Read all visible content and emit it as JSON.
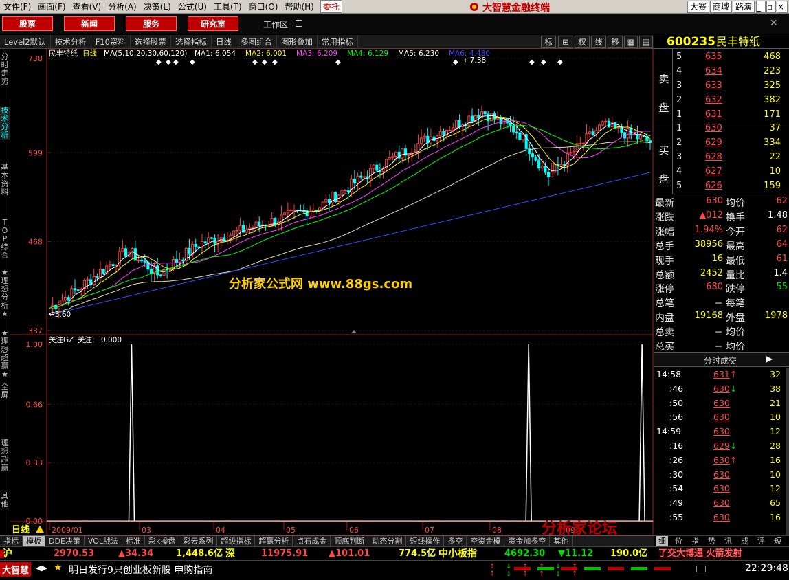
{
  "menu": {
    "items": [
      "文件(F)",
      "画面(F)",
      "查看(V)",
      "分析(A)",
      "决策(L)",
      "公式(U)",
      "工具(T)",
      "窗口(O)",
      "帮助(H)"
    ],
    "entrust": "委托",
    "brand": "大智慧金融终端",
    "right": [
      "大赛",
      "商城",
      "路演"
    ]
  },
  "toolbar": {
    "buttons": [
      "股票",
      "新闻",
      "服务",
      "研究室"
    ],
    "workarea": "工作区"
  },
  "subbar": {
    "items": [
      "Level2默认",
      "技术分析",
      "F10资料",
      "选择股票",
      "选择指标",
      "日线",
      "多图组合",
      "图形叠加",
      "常用指标"
    ],
    "right": [
      "标",
      "权",
      "线",
      "移"
    ]
  },
  "left_tabs": [
    {
      "label": "分时走势",
      "active": false
    },
    {
      "label": "技术分析",
      "active": true
    },
    {
      "label": "基本资料",
      "active": false
    },
    {
      "label": "TOP综合",
      "active": false
    },
    {
      "label": "★理想分析★",
      "active": false
    },
    {
      "label": "★理想超赢★",
      "active": false
    },
    {
      "label": "全屏",
      "active": false
    },
    {
      "label": "理想超赢",
      "active": false
    },
    {
      "label": "其他",
      "active": false
    }
  ],
  "chart_header": {
    "name": "民丰特纸",
    "period": "日线",
    "ma_title": "MA(5,10,20,30,60,120)",
    "ma": [
      {
        "label": "MA1:",
        "value": "6.054",
        "color": "#ffffff"
      },
      {
        "label": "MA2:",
        "value": "6.001",
        "color": "#ffff00"
      },
      {
        "label": "MA3:",
        "value": "6.209",
        "color": "#ff40ff"
      },
      {
        "label": "MA4:",
        "value": "6.129",
        "color": "#00ff00"
      },
      {
        "label": "MA5:",
        "value": "6.230",
        "color": "#ffffff"
      },
      {
        "label": "MA6:",
        "value": "4.480",
        "color": "#4040ff"
      }
    ]
  },
  "indicator": {
    "title": "关注GZ",
    "label": "关注:",
    "value": "0.000"
  },
  "watermark": "分析家公式网 www.88gs.com",
  "corner_logo": "分析家论坛",
  "chart_data": [
    {
      "type": "candlestick",
      "title": "民丰特纸",
      "ylim": [
        337,
        738
      ],
      "yticks": [
        "738",
        "599",
        "468",
        "337"
      ],
      "high_label": "7.38",
      "low_label": "3.60",
      "ma_colors": [
        "#ffffff",
        "#ffff00",
        "#ff40ff",
        "#00ff00",
        "#e0e0b0",
        "#3050ff"
      ]
    },
    {
      "type": "line",
      "title": "关注GZ",
      "ylim": [
        0,
        1
      ],
      "yticks": [
        "1.00",
        "0.66",
        "0.33",
        "0.00"
      ],
      "x_labels": [
        "2009/01",
        "03",
        "04",
        "05",
        "06",
        "07",
        "08",
        "09"
      ],
      "spikes_at": [
        0.14,
        0.795,
        0.982
      ]
    }
  ],
  "period_label": "日线",
  "stock": {
    "code": "600235",
    "name": "民丰特纸"
  },
  "orderbook": {
    "sell_label": [
      "卖",
      "盘"
    ],
    "buy_label": [
      "买",
      "盘"
    ],
    "sell": [
      {
        "lvl": "5",
        "price": "635",
        "vol": "468"
      },
      {
        "lvl": "4",
        "price": "634",
        "vol": "223"
      },
      {
        "lvl": "3",
        "price": "633",
        "vol": "325"
      },
      {
        "lvl": "2",
        "price": "632",
        "vol": "382"
      },
      {
        "lvl": "1",
        "price": "631",
        "vol": "171"
      }
    ],
    "buy": [
      {
        "lvl": "1",
        "price": "630",
        "vol": "37"
      },
      {
        "lvl": "2",
        "price": "629",
        "vol": "334"
      },
      {
        "lvl": "3",
        "price": "628",
        "vol": "22"
      },
      {
        "lvl": "4",
        "price": "627",
        "vol": "10"
      },
      {
        "lvl": "5",
        "price": "626",
        "vol": "159"
      }
    ]
  },
  "stats": [
    {
      "l1": "最新",
      "v1": "630",
      "c1": "red",
      "l2": "均价",
      "v2": "62",
      "c2": "red"
    },
    {
      "l1": "涨跌",
      "v1": "▲012",
      "c1": "red",
      "l2": "换手",
      "v2": "1.48",
      "c2": "white"
    },
    {
      "l1": "涨幅",
      "v1": "1.94%",
      "c1": "red",
      "l2": "今开",
      "v2": "62",
      "c2": "red"
    },
    {
      "l1": "总手",
      "v1": "38956",
      "c1": "yellow",
      "l2": "最高",
      "v2": "64",
      "c2": "red"
    },
    {
      "l1": "现手",
      "v1": "16",
      "c1": "yellow",
      "l2": "最低",
      "v2": "61",
      "c2": "red"
    },
    {
      "l1": "总额",
      "v1": "2452",
      "c1": "yellow",
      "l2": "量比",
      "v2": "1.4",
      "c2": "white"
    },
    {
      "l1": "涨停",
      "v1": "680",
      "c1": "red",
      "l2": "跌停",
      "v2": "55",
      "c2": "green"
    },
    {
      "l1": "总笔",
      "v1": "－",
      "c1": "white",
      "l2": "每笔",
      "v2": "",
      "c2": "white"
    },
    {
      "l1": "内盘",
      "v1": "19168",
      "c1": "yellow",
      "l2": "外盘",
      "v2": "1978",
      "c2": "yellow"
    },
    {
      "l1": "总卖",
      "v1": "－",
      "c1": "white",
      "l2": "均价",
      "v2": "",
      "c2": "white"
    },
    {
      "l1": "总买",
      "v1": "－",
      "c1": "white",
      "l2": "均价",
      "v2": "",
      "c2": "white"
    }
  ],
  "ticks_header": "分时成交",
  "ticks": [
    {
      "time": "14:58",
      "price": "631",
      "arrow": "↑",
      "vol": "32",
      "pc": "red",
      "vc": "yellow"
    },
    {
      "time": ":46",
      "price": "630",
      "arrow": "↓",
      "vol": "38",
      "pc": "red",
      "vc": "yellow"
    },
    {
      "time": ":50",
      "price": "630",
      "arrow": "",
      "vol": "21",
      "pc": "red",
      "vc": "yellow"
    },
    {
      "time": ":56",
      "price": "630",
      "arrow": "",
      "vol": "10",
      "pc": "red",
      "vc": "yellow"
    },
    {
      "time": "14:59",
      "price": "630",
      "arrow": "",
      "vol": "12",
      "pc": "red",
      "vc": "yellow"
    },
    {
      "time": ":16",
      "price": "629",
      "arrow": "↓",
      "vol": "28",
      "pc": "red",
      "vc": "yellow"
    },
    {
      "time": ":26",
      "price": "630",
      "arrow": "↑",
      "vol": "16",
      "pc": "red",
      "vc": "yellow"
    },
    {
      "time": ":30",
      "price": "630",
      "arrow": "",
      "vol": "10",
      "pc": "red",
      "vc": "yellow"
    },
    {
      "time": ":54",
      "price": "630",
      "arrow": "",
      "vol": "12",
      "pc": "red",
      "vc": "yellow"
    },
    {
      "time": ":49",
      "price": "630",
      "arrow": "",
      "vol": "65",
      "pc": "red",
      "vc": "yellow"
    },
    {
      "time": ":55",
      "price": "630",
      "arrow": "",
      "vol": "16",
      "pc": "red",
      "vc": "yellow"
    }
  ],
  "bottom_tabs": [
    "指标",
    "模板",
    "DDE决策",
    "VOL战法",
    "标准",
    "彩k操盘",
    "彩云系列",
    "超级指标",
    "超赢分析",
    "点石成金",
    "顶底判断",
    "动态分割",
    "短线操作",
    "多空",
    "空资金模",
    "资金加多空",
    "其他"
  ],
  "right_tabs": [
    "细",
    "价",
    "指",
    "势",
    "讯",
    "成",
    "评",
    "短"
  ],
  "index_bar": [
    {
      "name": "沪",
      "value": "2970.53",
      "chg": "▲34.34",
      "amt": "1,448.6亿"
    },
    {
      "name": "深",
      "value": "11975.91",
      "chg": "▲101.01",
      "amt": "774.5亿"
    },
    {
      "name": "中小板指",
      "value": "4692.30",
      "chg": "▼11.12",
      "amt": "190.0亿"
    }
  ],
  "ticker_right": "了交大博通 火箭发射",
  "status": {
    "app": "大智慧",
    "news": "明日发行9只创业板新股 申购指南",
    "clock": "22:29:48"
  }
}
